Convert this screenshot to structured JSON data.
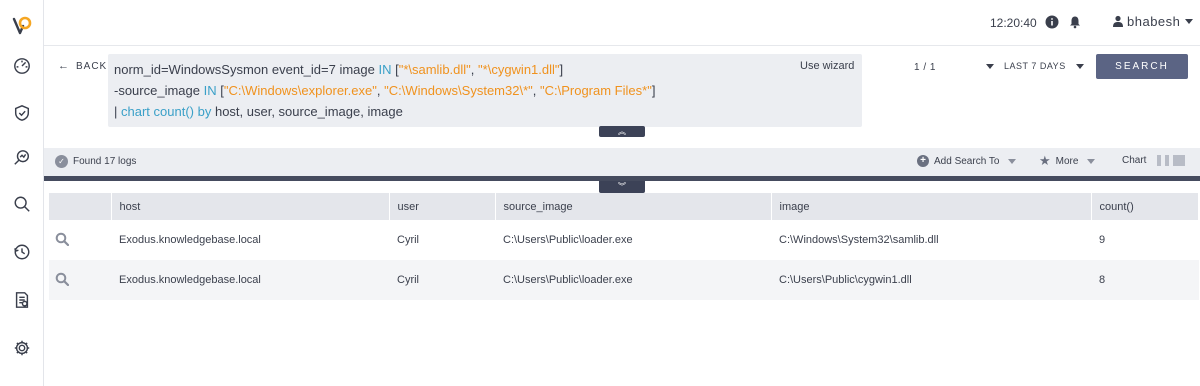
{
  "topbar": {
    "time": "12:20:40",
    "username": "bhabesh"
  },
  "query": {
    "back_label": "BACK",
    "use_wizard": "Use wizard",
    "line1": {
      "prefix": "norm_id=WindowsSysmon event_id=7 image ",
      "kw_in": "IN",
      "open": " [",
      "str1": "\"*\\samlib.dll\"",
      "sep": ", ",
      "str2": "\"*\\cygwin1.dll\"",
      "close": "]"
    },
    "line2": {
      "prefix": "-source_image ",
      "kw_in": "IN",
      "open": " [",
      "str1": "\"C:\\Windows\\explorer.exe\"",
      "sep1": ", ",
      "str2": "\"C:\\Windows\\System32\\*\"",
      "sep2": ", ",
      "str3": "\"C:\\Program Files*\"",
      "close": "]"
    },
    "line3": {
      "pipe": "| ",
      "kw_chart": "chart",
      "sp": " ",
      "kw_count": "count()",
      "sp2": " ",
      "kw_by": "by",
      "rest": " host, user, source_image, image"
    },
    "pager": "1 / 1",
    "time_range": "LAST 7 DAYS",
    "search_label": "SEARCH"
  },
  "results": {
    "found": "Found 17 logs",
    "add_search": "Add Search To",
    "more": "More",
    "chart": "Chart"
  },
  "table": {
    "columns": [
      "host",
      "user",
      "source_image",
      "image",
      "count()"
    ],
    "rows": [
      {
        "host": "Exodus.knowledgebase.local",
        "user": "Cyril",
        "source_image": "C:\\Users\\Public\\loader.exe",
        "image": "C:\\Windows\\System32\\samlib.dll",
        "count": "9"
      },
      {
        "host": "Exodus.knowledgebase.local",
        "user": "Cyril",
        "source_image": "C:\\Users\\Public\\loader.exe",
        "image": "C:\\Users\\Public\\cygwin1.dll",
        "count": "8"
      }
    ]
  },
  "colors": {
    "keyword": "#3aa0c8",
    "string": "#f0921e",
    "search_button": "#5b6484",
    "logo": "#f5a623"
  },
  "icons": {
    "sidebar": [
      "logo",
      "dashboard-icon",
      "shield-icon",
      "search-analytics-icon",
      "search-icon",
      "history-icon",
      "report-icon",
      "settings-icon"
    ]
  }
}
